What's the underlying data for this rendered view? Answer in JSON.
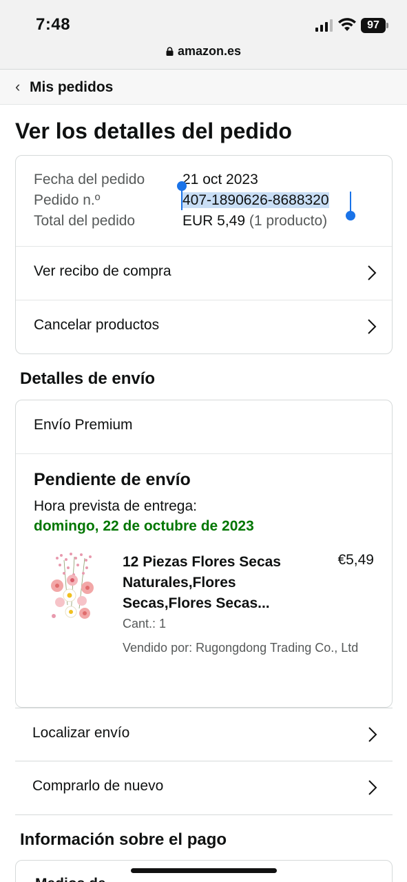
{
  "status_bar": {
    "time": "7:48",
    "battery": "97"
  },
  "browser": {
    "url": "amazon.es"
  },
  "breadcrumb": {
    "label": "Mis pedidos"
  },
  "page_title": "Ver los detalles del pedido",
  "order_summary": {
    "date_label": "Fecha del pedido",
    "date_value": "21 oct 2023",
    "number_label": "Pedido n.º",
    "number_value": "407-1890626-8688320",
    "total_label": "Total del pedido",
    "total_value": "EUR 5,49",
    "total_note": "(1 producto)"
  },
  "order_actions": [
    {
      "label": "Ver recibo de compra"
    },
    {
      "label": "Cancelar productos"
    }
  ],
  "shipping": {
    "heading": "Detalles de envío",
    "service": "Envío Premium",
    "status": "Pendiente de envío",
    "eta_label": "Hora prevista de entrega:",
    "eta_date": "domingo, 22 de octubre de 2023",
    "item": {
      "title": "12 Piezas Flores Secas Naturales,Flores Secas,Flores Secas...",
      "price": "€5,49",
      "quantity": "Cant.: 1",
      "seller": "Vendido por: Rugongdong Trading Co., Ltd"
    }
  },
  "shipping_actions": [
    {
      "label": "Localizar envío"
    },
    {
      "label": "Comprarlo de nuevo"
    }
  ],
  "payment": {
    "heading": "Información sobre el pago",
    "partial_label": "Medios de"
  },
  "colors": {
    "accent_green": "#007600",
    "selection": "#c9def5",
    "handle_blue": "#1a73e8"
  }
}
